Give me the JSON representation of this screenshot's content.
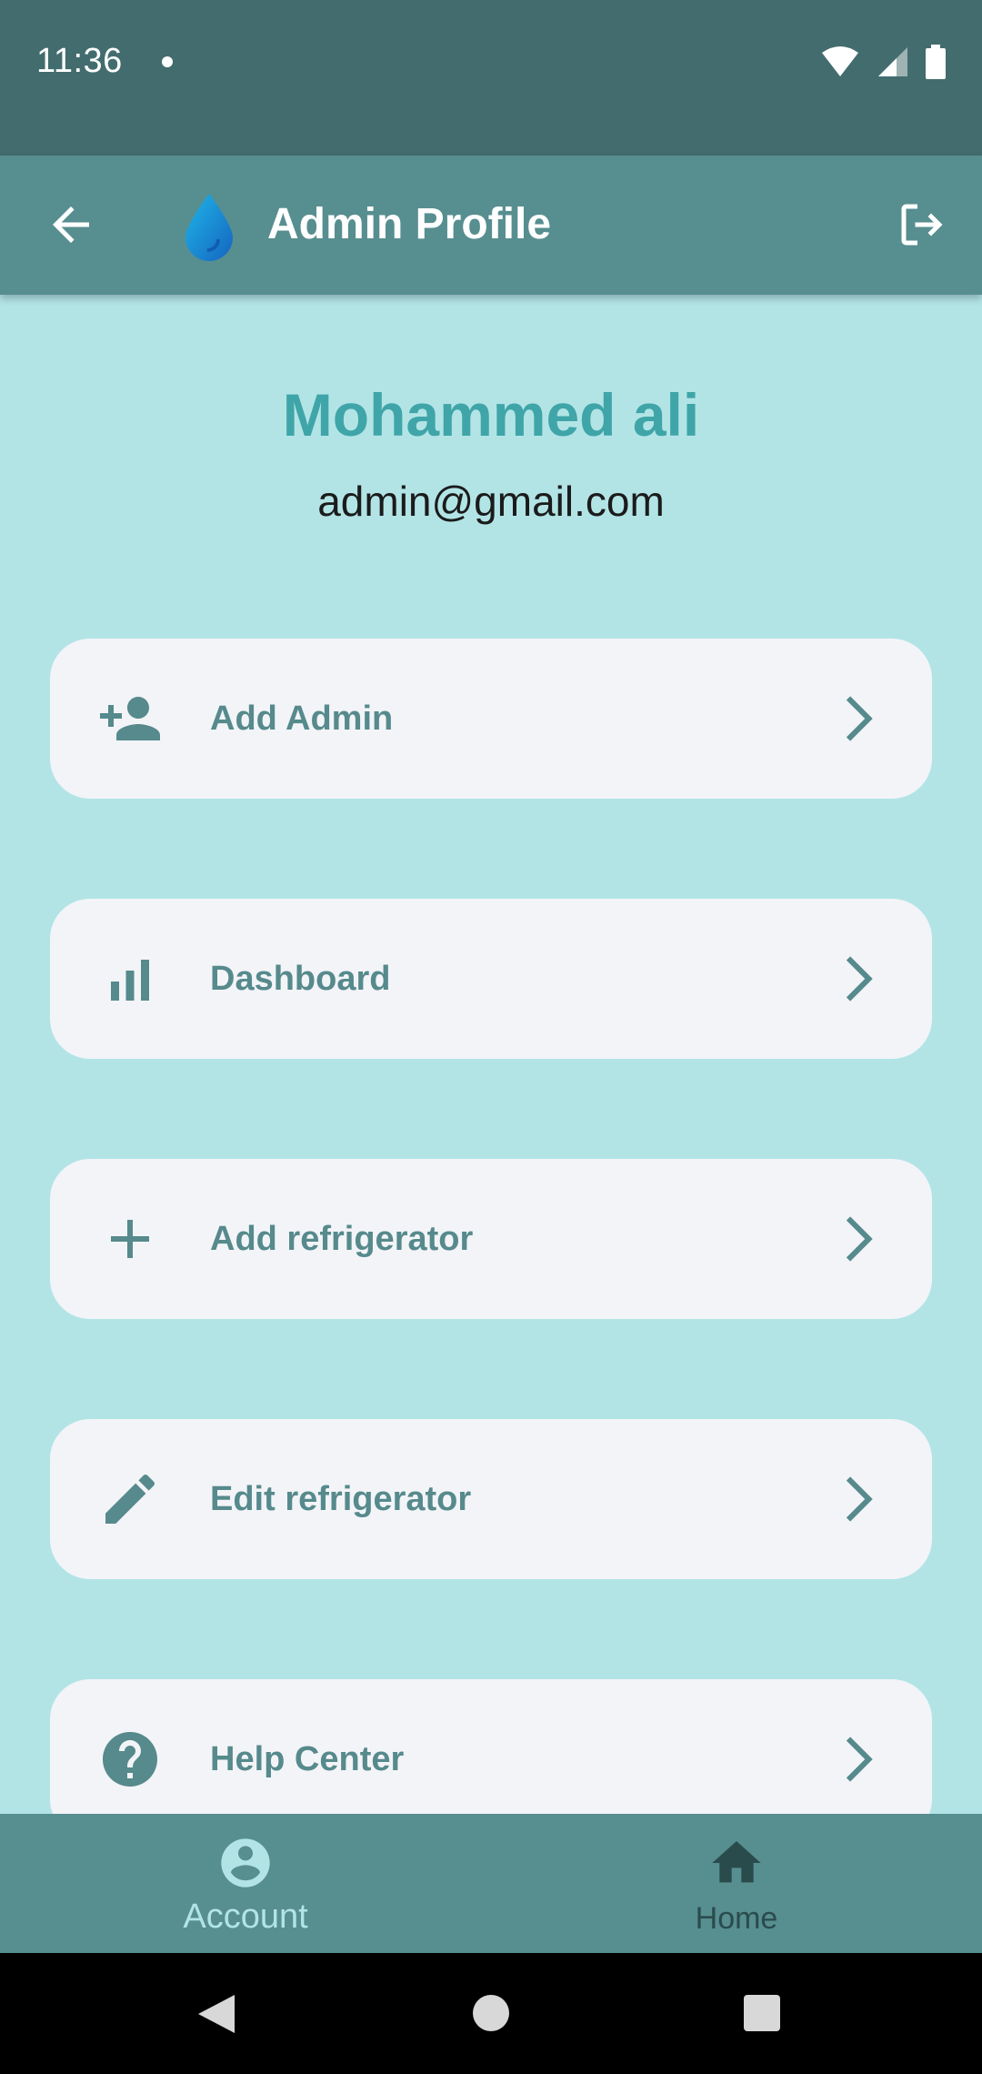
{
  "status_bar": {
    "time": "11:36"
  },
  "app_bar": {
    "title": "Admin Profile"
  },
  "profile": {
    "name": "Mohammed ali",
    "email": "admin@gmail.com"
  },
  "menu": [
    {
      "label": "Add Admin",
      "icon": "person-add-icon"
    },
    {
      "label": "Dashboard",
      "icon": "bar-chart-icon"
    },
    {
      "label": "Add refrigerator",
      "icon": "plus-icon"
    },
    {
      "label": "Edit refrigerator",
      "icon": "pencil-icon"
    },
    {
      "label": "Help Center",
      "icon": "help-icon"
    }
  ],
  "bottom_nav": [
    {
      "label": "Account",
      "icon": "account-circle-icon",
      "active": true
    },
    {
      "label": "Home",
      "icon": "home-icon",
      "active": false
    }
  ],
  "colors": {
    "background": "#b2e4e6",
    "app_bar": "#578e90",
    "status_bar": "#436c6e",
    "accent_name": "#3fa5a8",
    "card": "#f3f4f8",
    "icon": "#568a8c"
  }
}
